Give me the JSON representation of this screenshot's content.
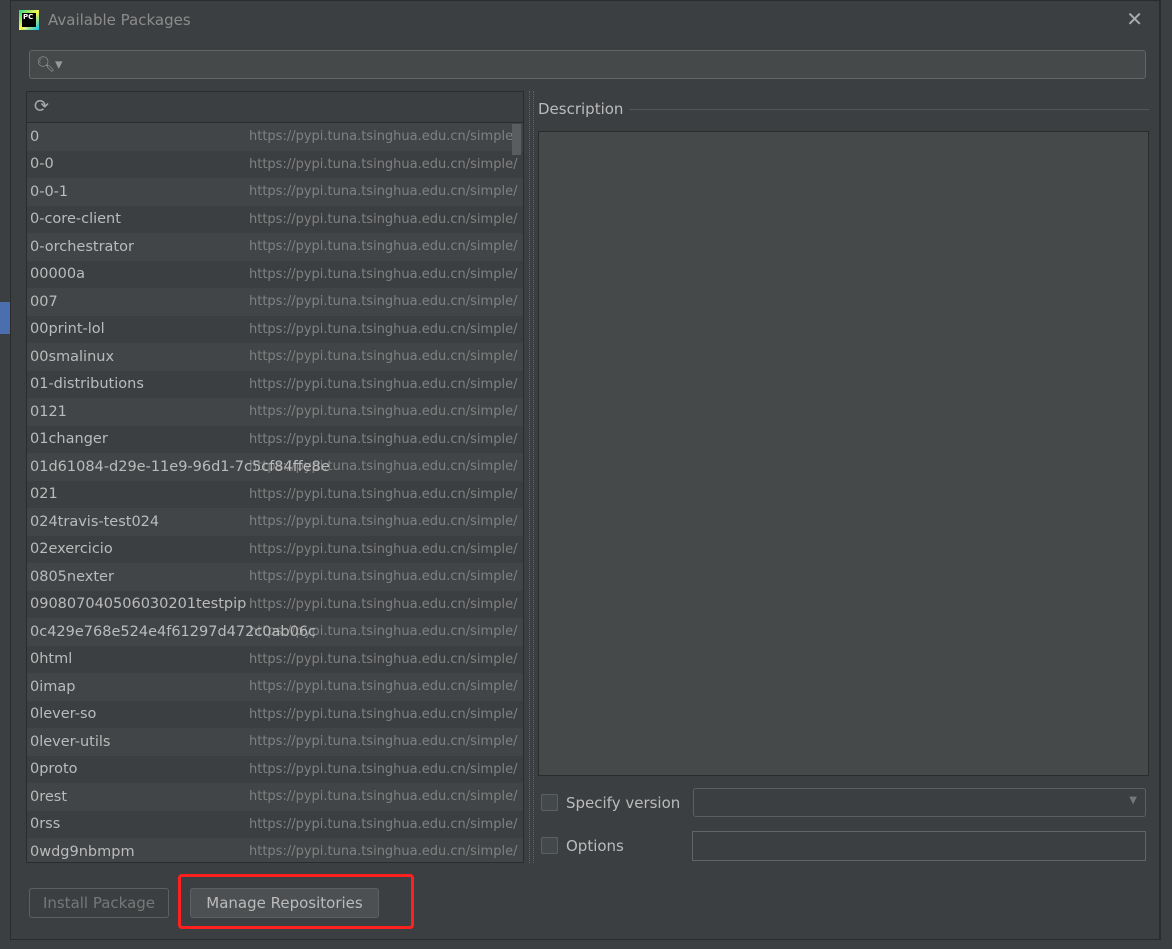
{
  "dialog": {
    "title": "Available Packages",
    "close_icon": "close-icon"
  },
  "search": {
    "placeholder": "",
    "value": ""
  },
  "packages": [
    {
      "name": "0",
      "repo": "https://pypi.tuna.tsinghua.edu.cn/simple/"
    },
    {
      "name": "0-0",
      "repo": "https://pypi.tuna.tsinghua.edu.cn/simple/"
    },
    {
      "name": "0-0-1",
      "repo": "https://pypi.tuna.tsinghua.edu.cn/simple/"
    },
    {
      "name": "0-core-client",
      "repo": "https://pypi.tuna.tsinghua.edu.cn/simple/"
    },
    {
      "name": "0-orchestrator",
      "repo": "https://pypi.tuna.tsinghua.edu.cn/simple/"
    },
    {
      "name": "00000a",
      "repo": "https://pypi.tuna.tsinghua.edu.cn/simple/"
    },
    {
      "name": "007",
      "repo": "https://pypi.tuna.tsinghua.edu.cn/simple/"
    },
    {
      "name": "00print-lol",
      "repo": "https://pypi.tuna.tsinghua.edu.cn/simple/"
    },
    {
      "name": "00smalinux",
      "repo": "https://pypi.tuna.tsinghua.edu.cn/simple/"
    },
    {
      "name": "01-distributions",
      "repo": "https://pypi.tuna.tsinghua.edu.cn/simple/"
    },
    {
      "name": "0121",
      "repo": "https://pypi.tuna.tsinghua.edu.cn/simple/"
    },
    {
      "name": "01changer",
      "repo": "https://pypi.tuna.tsinghua.edu.cn/simple/"
    },
    {
      "name": "01d61084-d29e-11e9-96d1-7c5cf84ffe8e",
      "repo": "https://pypi.tuna.tsinghua.edu.cn/simple/"
    },
    {
      "name": "021",
      "repo": "https://pypi.tuna.tsinghua.edu.cn/simple/"
    },
    {
      "name": "024travis-test024",
      "repo": "https://pypi.tuna.tsinghua.edu.cn/simple/"
    },
    {
      "name": "02exercicio",
      "repo": "https://pypi.tuna.tsinghua.edu.cn/simple/"
    },
    {
      "name": "0805nexter",
      "repo": "https://pypi.tuna.tsinghua.edu.cn/simple/"
    },
    {
      "name": "090807040506030201testpip",
      "repo": "https://pypi.tuna.tsinghua.edu.cn/simple/"
    },
    {
      "name": "0c429e768e524e4f61297d472c0ab06c",
      "repo": "https://pypi.tuna.tsinghua.edu.cn/simple/"
    },
    {
      "name": "0html",
      "repo": "https://pypi.tuna.tsinghua.edu.cn/simple/"
    },
    {
      "name": "0imap",
      "repo": "https://pypi.tuna.tsinghua.edu.cn/simple/"
    },
    {
      "name": "0lever-so",
      "repo": "https://pypi.tuna.tsinghua.edu.cn/simple/"
    },
    {
      "name": "0lever-utils",
      "repo": "https://pypi.tuna.tsinghua.edu.cn/simple/"
    },
    {
      "name": "0proto",
      "repo": "https://pypi.tuna.tsinghua.edu.cn/simple/"
    },
    {
      "name": "0rest",
      "repo": "https://pypi.tuna.tsinghua.edu.cn/simple/"
    },
    {
      "name": "0rss",
      "repo": "https://pypi.tuna.tsinghua.edu.cn/simple/"
    },
    {
      "name": "0wdg9nbmpm",
      "repo": "https://pypi.tuna.tsinghua.edu.cn/simple/"
    }
  ],
  "description": {
    "label": "Description",
    "text": ""
  },
  "options": {
    "specify_version_label": "Specify version",
    "specify_version_checked": false,
    "version_value": "",
    "options_label": "Options",
    "options_checked": false,
    "options_value": ""
  },
  "buttons": {
    "install": "Install Package",
    "manage": "Manage Repositories"
  },
  "highlight_color": "#ff2020"
}
